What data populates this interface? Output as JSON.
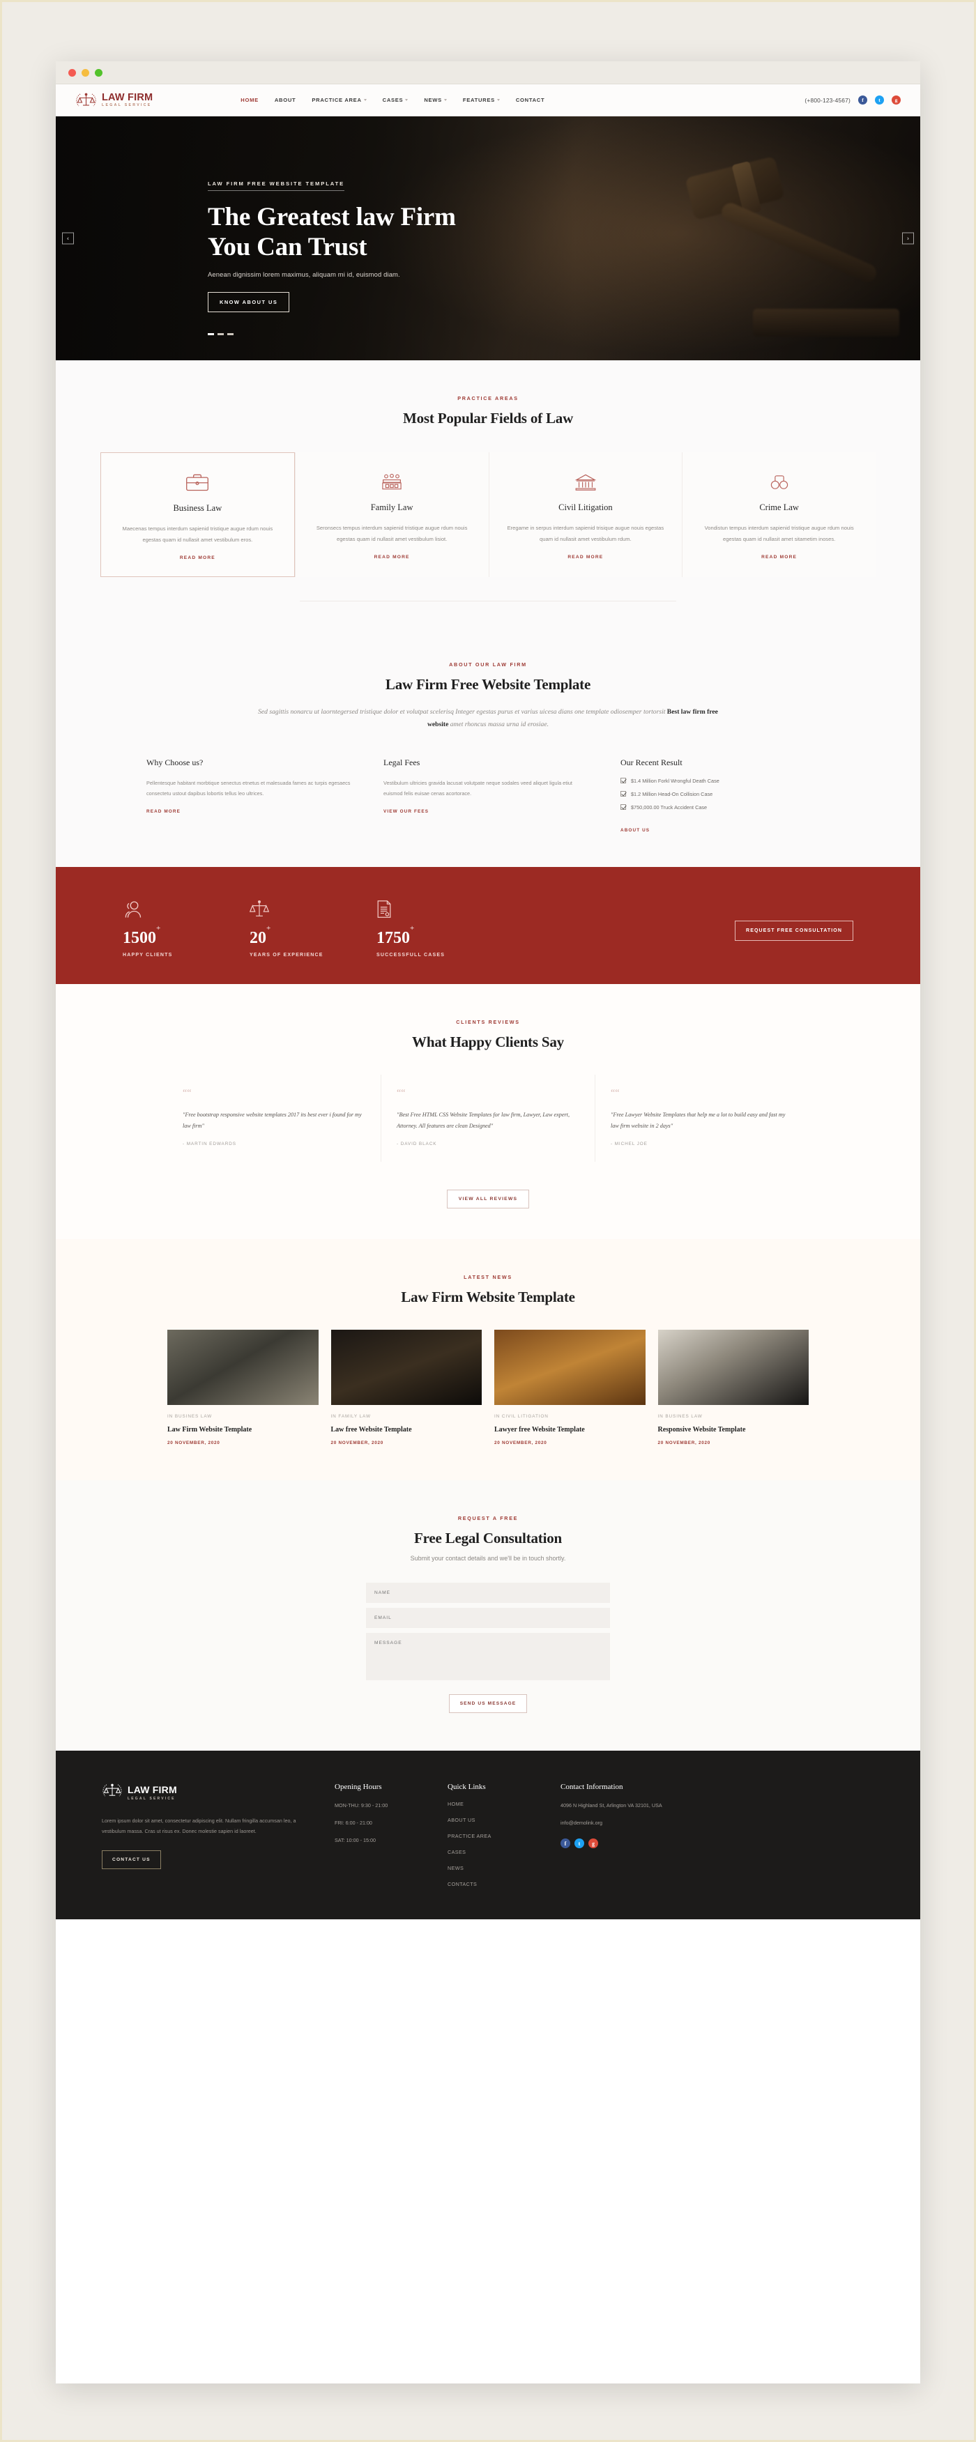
{
  "nav": {
    "logo": {
      "line1": "LAW FIRM",
      "line2": "LEGAL SERVICE"
    },
    "links": [
      {
        "label": "HOME",
        "active": true
      },
      {
        "label": "ABOUT",
        "active": false
      },
      {
        "label": "PRACTICE AREA",
        "caret": true
      },
      {
        "label": "CASES",
        "caret": true
      },
      {
        "label": "NEWS",
        "caret": true
      },
      {
        "label": "FEATURES",
        "caret": true
      },
      {
        "label": "CONTACT",
        "active": false
      }
    ],
    "phone": "(+800-123-4567)",
    "social": [
      "facebook-icon",
      "twitter-icon",
      "google-plus-icon"
    ]
  },
  "hero": {
    "kicker": "LAW FIRM FREE WEBSITE TEMPLATE",
    "title_line1": "The Greatest law Firm",
    "title_line2": "You Can Trust",
    "subtitle": "Aenean dignissim lorem maximus, aliquam mi id, euismod diam.",
    "button": "KNOW ABOUT US",
    "arrow_prev": "‹",
    "arrow_next": "›"
  },
  "practice": {
    "kicker": "PRACTICE AREAS",
    "title": "Most Popular Fields of Law",
    "read_more": "READ MORE",
    "cards": [
      {
        "icon": "briefcase-icon",
        "title": "Business Law",
        "text": "Maecenas tempus interdum sapienid tristique augue rdum nouis egestas quam id nullasit amet vestibulum eros."
      },
      {
        "icon": "courthouse-icon",
        "title": "Family Law",
        "text": "Seronsecs tempus interdum sapienid tristique augue rdum nouis egestas quam id nullasit amet vestibulum lisiot."
      },
      {
        "icon": "bank-columns-icon",
        "title": "Civil Litigation",
        "text": "Eregame in serpus interdum sapienid trisique augue nouis egestas quam id nullasit amet vestibulum rdum."
      },
      {
        "icon": "handcuffs-icon",
        "title": "Crime Law",
        "text": "Vondistun tempus interdum sapienid tristique augue rdum nouis egestas quam id nullasit amet sitametim inoses."
      }
    ]
  },
  "about": {
    "kicker": "ABOUT OUR LAW FIRM",
    "title": "Law Firm Free Website Template",
    "lead_part1": "Sed sagittis nonarcu ut laorntegersed tristique dolor et volutpat scelerisq Integer egestas purus et varius uicesa dians one template odiosemper tortorsit ",
    "lead_bold": "Best law firm free website",
    "lead_part2": " amet rhoncus massa urna id erosiae.",
    "columns": [
      {
        "title": "Why Choose us?",
        "text": "Pellentesque habitant morbtique senectus etnetus et malesuada fames ac turpis egesaecs consectetu ustout dapibus lobortis tellus leo ultrices.",
        "link": "READ MORE"
      },
      {
        "title": "Legal Fees",
        "text": "Vestibulum ultricies gravida lacusat volutpate neque sodales veed aliquet ligula etiut euismod felis euisae cenas acortorace.",
        "link": "VIEW OUR FEES"
      }
    ],
    "results_title": "Our Recent Result",
    "results": [
      "$1.4 Million Forkl Wrongful Death Case",
      "$1.2 Million Head-On Collision Case",
      "$750,000.00 Truck Accident Case"
    ],
    "results_link": "ABOUT US"
  },
  "stats": {
    "items": [
      {
        "icon": "people-icon",
        "number": "1500",
        "plus": "+",
        "label": "HAPPY CLIENTS"
      },
      {
        "icon": "scales-icon",
        "number": "20",
        "plus": "+",
        "label": "YEARS OF EXPERIENCE"
      },
      {
        "icon": "document-icon",
        "number": "1750",
        "plus": "+",
        "label": "SUCCESSFULL CASES"
      }
    ],
    "button": "REQUEST FREE CONSULTATION",
    "bg_color": "#9c2a23"
  },
  "reviews": {
    "kicker": "CLIENTS REVIEWS",
    "title": "What Happy Clients Say",
    "items": [
      {
        "quote": "\"Free bootstrap responsive website templates 2017 its best ever i found for my law firm\"",
        "author": "- MARTIN EDWARDS"
      },
      {
        "quote": "\"Best Free HTML CSS Website Templates for law firm, Lawyer, Law expert, Attorney. All features are clean Designed\"",
        "author": "- DAVID BLACK"
      },
      {
        "quote": "\"Free Lawyer Website Templates that help me a lot to build easy and fast my law firm website in 2 days\"",
        "author": "- MICHEL JOE"
      }
    ],
    "button": "VIEW ALL REVIEWS"
  },
  "news": {
    "kicker": "LATEST NEWS",
    "title": "Law Firm Website Template",
    "items": [
      {
        "category": "IN BUSINES LAW",
        "title": "Law Firm Website Template",
        "date": "20 NOVEMBER, 2020",
        "image": "lawyer-desk-photo"
      },
      {
        "category": "IN FAMILY LAW",
        "title": "Law free Website Template",
        "date": "20 NOVEMBER, 2020",
        "image": "gavel-photo"
      },
      {
        "category": "IN CIVIL LITIGATION",
        "title": "Lawyer free Website Template",
        "date": "20 NOVEMBER, 2020",
        "image": "law-books-photo"
      },
      {
        "category": "IN BUSINES LAW",
        "title": "Responsive Website Template",
        "date": "20 NOVEMBER, 2020",
        "image": "chess-photo"
      }
    ]
  },
  "contact": {
    "kicker": "REQUEST A FREE",
    "title": "Free Legal Consultation",
    "subtitle": "Submit your contact details and we'll be in touch shortly.",
    "name_placeholder": "NAME",
    "email_placeholder": "EMAIL",
    "message_placeholder": "MESSAGE",
    "submit": "SEND US MESSAGE"
  },
  "footer": {
    "logo": {
      "line1": "LAW FIRM",
      "line2": "LEGAL SERVICE"
    },
    "description": "Lorem ipsum dolor sit amet, consectetur adipiscing elit. Nullam fringilla accumsan leo, a vestibulum massa. Cras ut risus ex. Donec molestie sapien id laoreet.",
    "button": "CONTACT US",
    "hours_title": "Opening Hours",
    "hours": [
      "MON-THU: 9:30 - 21:00",
      "FRI: 6:00 - 21:00",
      "SAT: 10:00 - 15:00"
    ],
    "links_title": "Quick Links",
    "links": [
      "HOME",
      "ABOUT US",
      "PRACTICE AREA",
      "CASES",
      "NEWS",
      "CONTACTS"
    ],
    "info_title": "Contact Information",
    "address": "4096 N Highland St, Arlington VA 32101, USA",
    "email": "info@demolink.org",
    "social": [
      "facebook-icon",
      "twitter-icon",
      "google-plus-icon"
    ]
  }
}
